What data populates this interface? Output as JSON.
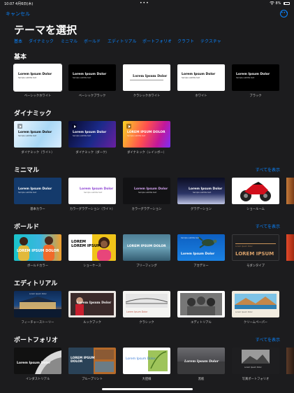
{
  "status_bar": {
    "time": "10:07",
    "date": "4月6日(木)",
    "dots": "•••",
    "battery_text": "8%",
    "battery_level": 0.08
  },
  "header": {
    "cancel_label": "キャンセル",
    "title": "テーマを選択",
    "more_icon": "ellipsis-circle-icon"
  },
  "categories": [
    "基本",
    "ダイナミック",
    "ミニマル",
    "ボールド",
    "エディトリアル",
    "ポートフォリオ",
    "クラフト",
    "テクスチャ"
  ],
  "see_all_label": "すべてを表示",
  "sample_text": {
    "title": "Lorem Ipsum Dolor",
    "subtitle": "Sample subtitle text",
    "title_caps": "LOREM IPSUM DOLOR",
    "lorem_ipsum": "LOREM IPSUM",
    "lorem": "LOREM"
  },
  "sections": {
    "basic": {
      "title": "基本",
      "items": [
        "ベーシックホワイト",
        "ベーシックブラック",
        "クラシックホワイト",
        "ホワイト",
        "ブラック"
      ]
    },
    "dynamic": {
      "title": "ダイナミック",
      "items": [
        "ダイナミック（ライト）",
        "ダイナミック（ダーク）",
        "ダイナミック（レインボー）"
      ]
    },
    "minimal": {
      "title": "ミニマル",
      "items": [
        "基本カラー",
        "カラーグラデーション（ライト）",
        "カラーグラデーション",
        "グラデーション",
        "ショールーム"
      ]
    },
    "bold": {
      "title": "ボールド",
      "items": [
        "ボールドカラー",
        "ショーケース",
        "ブリーフィング",
        "アカデミー",
        "モダンタイプ"
      ]
    },
    "editorial": {
      "title": "エディトリアル",
      "items": [
        "フィーチャーストーリー",
        "ルックブック",
        "クラシック",
        "エディトリアル",
        "クリームペーパー"
      ]
    },
    "portfolio": {
      "title": "ポートフォリオ",
      "items": [
        "インダストリアル",
        "ブループリント",
        "大胆線",
        "黒板",
        "写真ポートフォリオ"
      ]
    }
  },
  "colors": {
    "accent": "#0a84ff",
    "background": "#1c1c1e"
  }
}
